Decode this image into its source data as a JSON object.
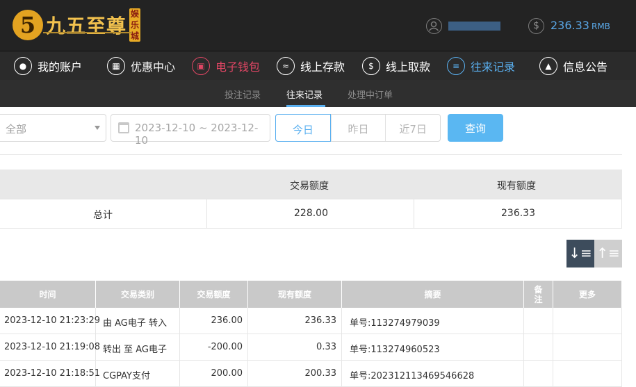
{
  "header": {
    "logo_mark": "5",
    "logo_name": "九五至尊",
    "logo_badge": "娱乐城",
    "balance": "236.33",
    "balance_unit": "RMB"
  },
  "nav": [
    {
      "label": "我的账户",
      "icon": "user-icon"
    },
    {
      "label": "优惠中心",
      "icon": "gift-icon"
    },
    {
      "label": "电子钱包",
      "icon": "wallet-icon"
    },
    {
      "label": "线上存款",
      "icon": "deposit-icon"
    },
    {
      "label": "线上取款",
      "icon": "withdraw-icon"
    },
    {
      "label": "往来记录",
      "icon": "record-icon"
    },
    {
      "label": "信息公告",
      "icon": "bell-icon"
    }
  ],
  "subnav": [
    "投注记录",
    "往来记录",
    "处理中订单"
  ],
  "filter": {
    "type_value": "全部",
    "date_range": "2023-12-10 ~ 2023-12-10",
    "quick": [
      "今日",
      "昨日",
      "近7日"
    ],
    "query_label": "查询"
  },
  "summary": {
    "headers": [
      "交易额度",
      "现有额度"
    ],
    "label": "总计",
    "amount": "228.00",
    "balance": "236.33"
  },
  "table": {
    "headers": [
      "时间",
      "交易类别",
      "交易额度",
      "现有额度",
      "摘要",
      "备注",
      "更多"
    ],
    "rows": [
      [
        "2023-12-10 21:23:29",
        "由 AG电子 转入",
        "236.00",
        "236.33",
        "单号:113274979039"
      ],
      [
        "2023-12-10 21:19:08",
        "转出 至 AG电子",
        "-200.00",
        "0.33",
        "单号:113274960523"
      ],
      [
        "2023-12-10 21:18:51",
        "CGPAY支付",
        "200.00",
        "200.33",
        "单号:202312113469546628"
      ]
    ]
  }
}
